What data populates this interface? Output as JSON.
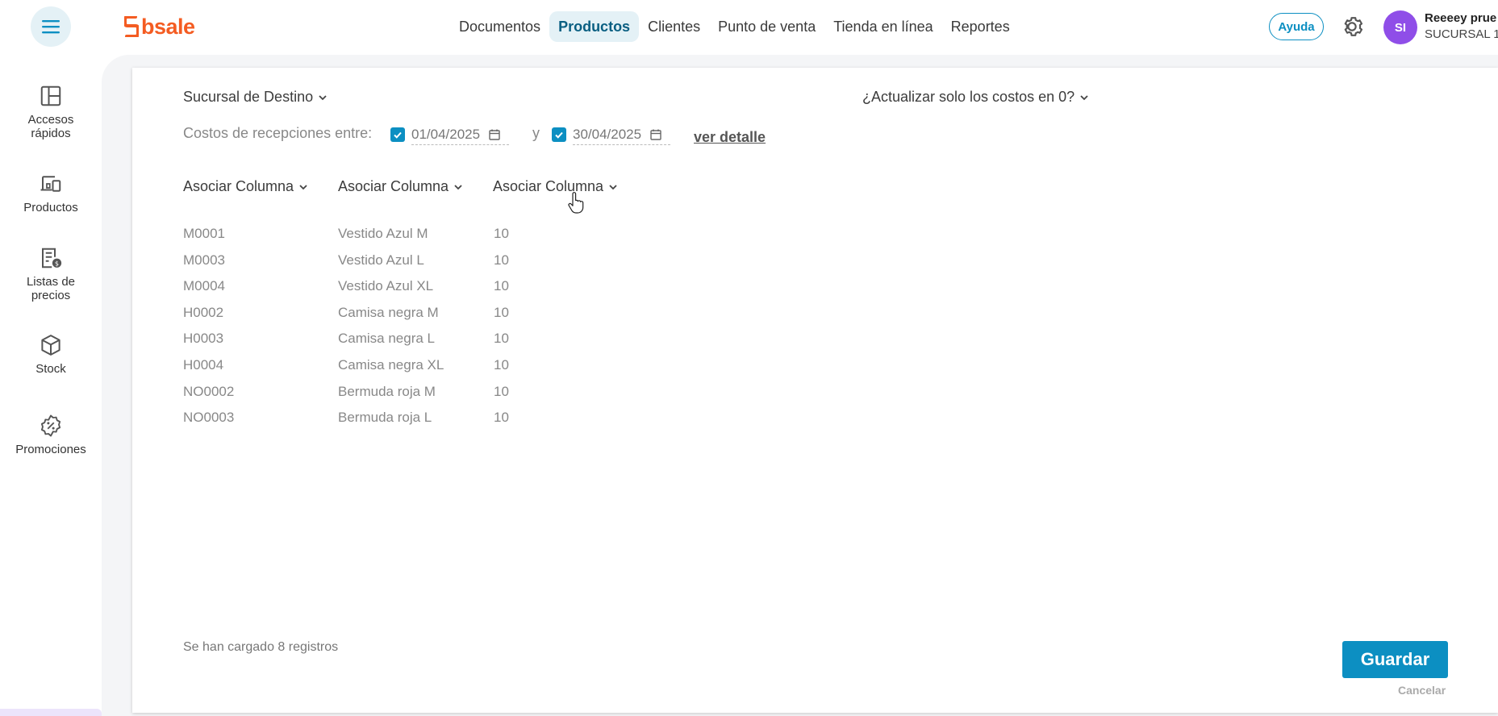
{
  "header": {
    "logo_text": "bsale",
    "nav": [
      "Documentos",
      "Productos",
      "Clientes",
      "Punto de venta",
      "Tienda en línea",
      "Reportes"
    ],
    "active_nav": "Productos",
    "help_label": "Ayuda",
    "avatar_initials": "SI",
    "user_name": "Reeeey prue",
    "user_branch": "SUCURSAL 1"
  },
  "sidebar": {
    "items": [
      {
        "label": "Accesos rápidos",
        "icon": "layout-icon"
      },
      {
        "label": "Productos",
        "icon": "devices-icon"
      },
      {
        "label": "Listas de precios",
        "icon": "price-list-icon"
      },
      {
        "label": "Stock",
        "icon": "box-icon"
      },
      {
        "label": "Promociones",
        "icon": "discount-badge-icon"
      }
    ]
  },
  "form": {
    "sucursal_destino": "Sucursal de Destino",
    "actualizar_costos": "¿Actualizar solo los costos en 0?",
    "costos_label": "Costos de recepciones entre:",
    "date_from": "01/04/2025",
    "date_to": "30/04/2025",
    "separator": "y",
    "ver_detalle": "ver detalle"
  },
  "table": {
    "column_headers": [
      "Asociar Columna",
      "Asociar Columna",
      "Asociar Columna"
    ],
    "rows": [
      [
        "M0001",
        "Vestido Azul M",
        "10"
      ],
      [
        "M0003",
        "Vestido Azul L",
        "10"
      ],
      [
        "M0004",
        "Vestido Azul XL",
        "10"
      ],
      [
        "H0002",
        "Camisa negra M",
        "10"
      ],
      [
        "H0003",
        "Camisa negra L",
        "10"
      ],
      [
        "H0004",
        "Camisa negra XL",
        "10"
      ],
      [
        "NO0002",
        "Bermuda roja M",
        "10"
      ],
      [
        "NO0003",
        "Bermuda roja L",
        "10"
      ]
    ]
  },
  "footer": {
    "loaded_text": "Se han cargado 8 registros",
    "save_label": "Guardar",
    "cancel_label": "Cancelar"
  },
  "colors": {
    "accent": "#0c8fc2",
    "brand": "#f45c22",
    "avatar": "#8f4ee8",
    "nav_active_bg": "#e4f1f6"
  }
}
